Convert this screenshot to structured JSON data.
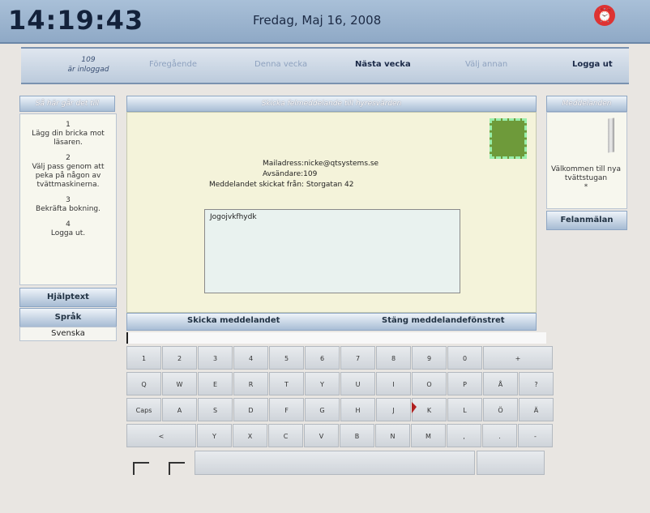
{
  "header": {
    "clock": "14:19:43",
    "date": "Fredag, Maj 16, 2008",
    "logo_icon": "alarm-clock-logo"
  },
  "nav": {
    "user_number": "109",
    "user_status": "är inloggad",
    "previous": "Föregående",
    "this_week": "Denna vecka",
    "next_week": "Nästa vecka",
    "choose_other": "Välj annan",
    "logout": "Logga ut"
  },
  "sidebar": {
    "heading": "Så här går det till",
    "steps": [
      {
        "number": "1",
        "text": "Lägg din bricka mot läsaren."
      },
      {
        "number": "2",
        "text": "Välj pass genom att peka på någon av tvättmaskinerna."
      },
      {
        "number": "3",
        "text": "Bekräfta bokning."
      },
      {
        "number": "4",
        "text": "Logga ut."
      }
    ],
    "help_button": "Hjälptext",
    "language_button": "Språk",
    "language_value": "Svenska"
  },
  "message": {
    "heading": "Skicka felmeddelande till hyresvärden",
    "mail_address": "Mailadress:nicke@qtsystems.se",
    "sender": "Avsändare:109",
    "sent_from": "Meddelandet skickat från: Storgatan 42",
    "body_text": "Jogojvkfhydk",
    "send_button": "Skicka meddelandet",
    "close_button": "Stäng meddelandefönstret",
    "accent_color": "#6e9a3a"
  },
  "keyboard": {
    "rows": [
      [
        "1",
        "2",
        "3",
        "4",
        "5",
        "6",
        "7",
        "8",
        "9",
        "0",
        "+"
      ],
      [
        "Q",
        "W",
        "E",
        "R",
        "T",
        "Y",
        "U",
        "I",
        "O",
        "P",
        "Å",
        "?"
      ],
      [
        "Caps",
        "A",
        "S",
        "D",
        "F",
        "G",
        "H",
        "J",
        "K",
        "L",
        "Ö",
        "Ä"
      ],
      [
        "<",
        "Y",
        "X",
        "C",
        "V",
        "B",
        "N",
        "M",
        ",",
        ".",
        "-"
      ]
    ]
  },
  "right_panel": {
    "heading": "Meddelanden",
    "message": "Välkommen till nya tvättstugan",
    "bullet": "*",
    "report_button": "Felanmälan"
  }
}
